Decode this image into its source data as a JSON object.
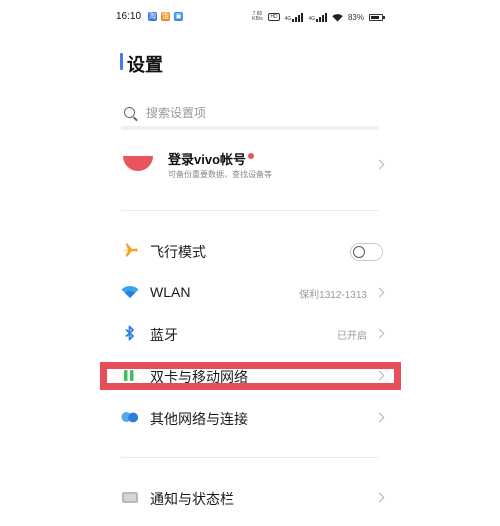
{
  "status_bar": {
    "time": "16:10",
    "apps": [
      {
        "icon": "taobao-icon",
        "color": "#3b7be6",
        "glyph": "淘"
      },
      {
        "icon": "orange-app-icon",
        "color": "#f08a24",
        "glyph": "饿"
      },
      {
        "icon": "blue-app-icon",
        "color": "#2f8df0",
        "glyph": "▣"
      }
    ],
    "net_speed": "7.80 KB/s",
    "hd_label": "HD",
    "network_1": "4G",
    "network_2": "4G",
    "battery_text": "83%",
    "battery_level": 0.83
  },
  "page": {
    "title": "设置"
  },
  "search": {
    "placeholder": "搜索设置项"
  },
  "account": {
    "title": "登录vivo帐号",
    "subtitle": "可备份重要数据，查找设备等"
  },
  "settings": [
    {
      "label": "飞行模式",
      "icon": "airplane-icon",
      "value": "",
      "type": "toggle",
      "enabled": false
    },
    {
      "label": "WLAN",
      "icon": "wifi-icon",
      "value": "保利1312-1313",
      "type": "link"
    },
    {
      "label": "蓝牙",
      "icon": "bluetooth-icon",
      "value": "已开启",
      "type": "link"
    },
    {
      "label": "双卡与移动网络",
      "icon": "dual-sim-icon",
      "value": "",
      "type": "link"
    },
    {
      "label": "其他网络与连接",
      "icon": "connections-icon",
      "value": "",
      "type": "link"
    },
    {
      "label": "通知与状态栏",
      "icon": "notification-icon",
      "value": "",
      "type": "link"
    }
  ],
  "colors": {
    "accent": "#3f7de8",
    "highlight_box": "#e84d5c",
    "account_avatar": "#e9555d"
  }
}
